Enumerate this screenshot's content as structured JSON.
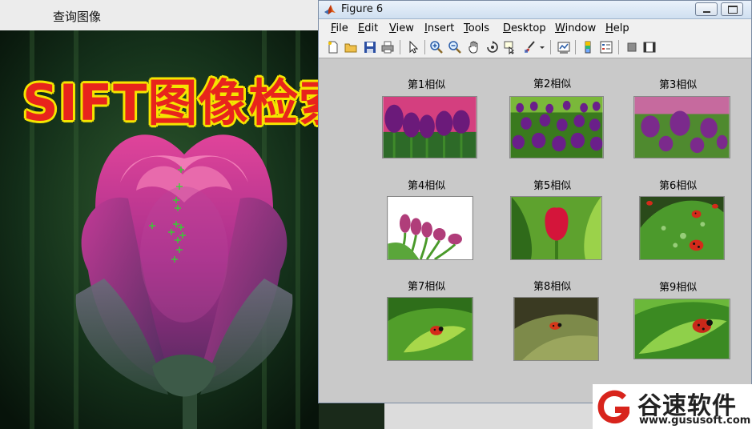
{
  "left_window": {
    "title": "查询图像",
    "banner_text": "SIFT图像检索"
  },
  "figure": {
    "title": "Figure 6",
    "menus": [
      {
        "label": "File",
        "u": "F",
        "rest": "ile"
      },
      {
        "label": "Edit",
        "u": "E",
        "rest": "dit"
      },
      {
        "label": "View",
        "u": "V",
        "rest": "iew"
      },
      {
        "label": "Insert",
        "u": "I",
        "rest": "nsert"
      },
      {
        "label": "Tools",
        "u": "T",
        "rest": "ools"
      },
      {
        "label": "Desktop",
        "u": "D",
        "rest": "esktop"
      },
      {
        "label": "Window",
        "u": "W",
        "rest": "indow"
      },
      {
        "label": "Help",
        "u": "H",
        "rest": "elp"
      }
    ],
    "toolbar_icons": [
      "new-file-icon",
      "open-folder-icon",
      "save-icon",
      "print-icon",
      "pointer-icon",
      "zoom-in-icon",
      "zoom-out-icon",
      "pan-hand-icon",
      "rotate-3d-icon",
      "data-cursor-icon",
      "brush-icon",
      "dropdown-arrow-icon",
      "link-plot-icon",
      "colorbar-icon",
      "legend-icon",
      "hide-plot-tools-icon",
      "show-plot-tools-icon"
    ],
    "results": [
      {
        "label": "第1相似",
        "scene": "purple-tulips"
      },
      {
        "label": "第2相似",
        "scene": "purple-tulip-field"
      },
      {
        "label": "第3相似",
        "scene": "purple-tulips"
      },
      {
        "label": "第4相似",
        "scene": "pink-tulips-white"
      },
      {
        "label": "第5相似",
        "scene": "red-tulip"
      },
      {
        "label": "第6相似",
        "scene": "ladybug-leaf"
      },
      {
        "label": "第7相似",
        "scene": "ladybug-leaf-small"
      },
      {
        "label": "第8相似",
        "scene": "ladybug-leaf-dark"
      },
      {
        "label": "第9相似",
        "scene": "ladybug-leaf-green"
      }
    ]
  },
  "watermark": {
    "name": "谷速软件",
    "url": "www.gususoft.com"
  },
  "colors": {
    "banner_red": "#e8241c",
    "banner_yellow": "#f5e500",
    "watermark_red": "#d8241c"
  }
}
